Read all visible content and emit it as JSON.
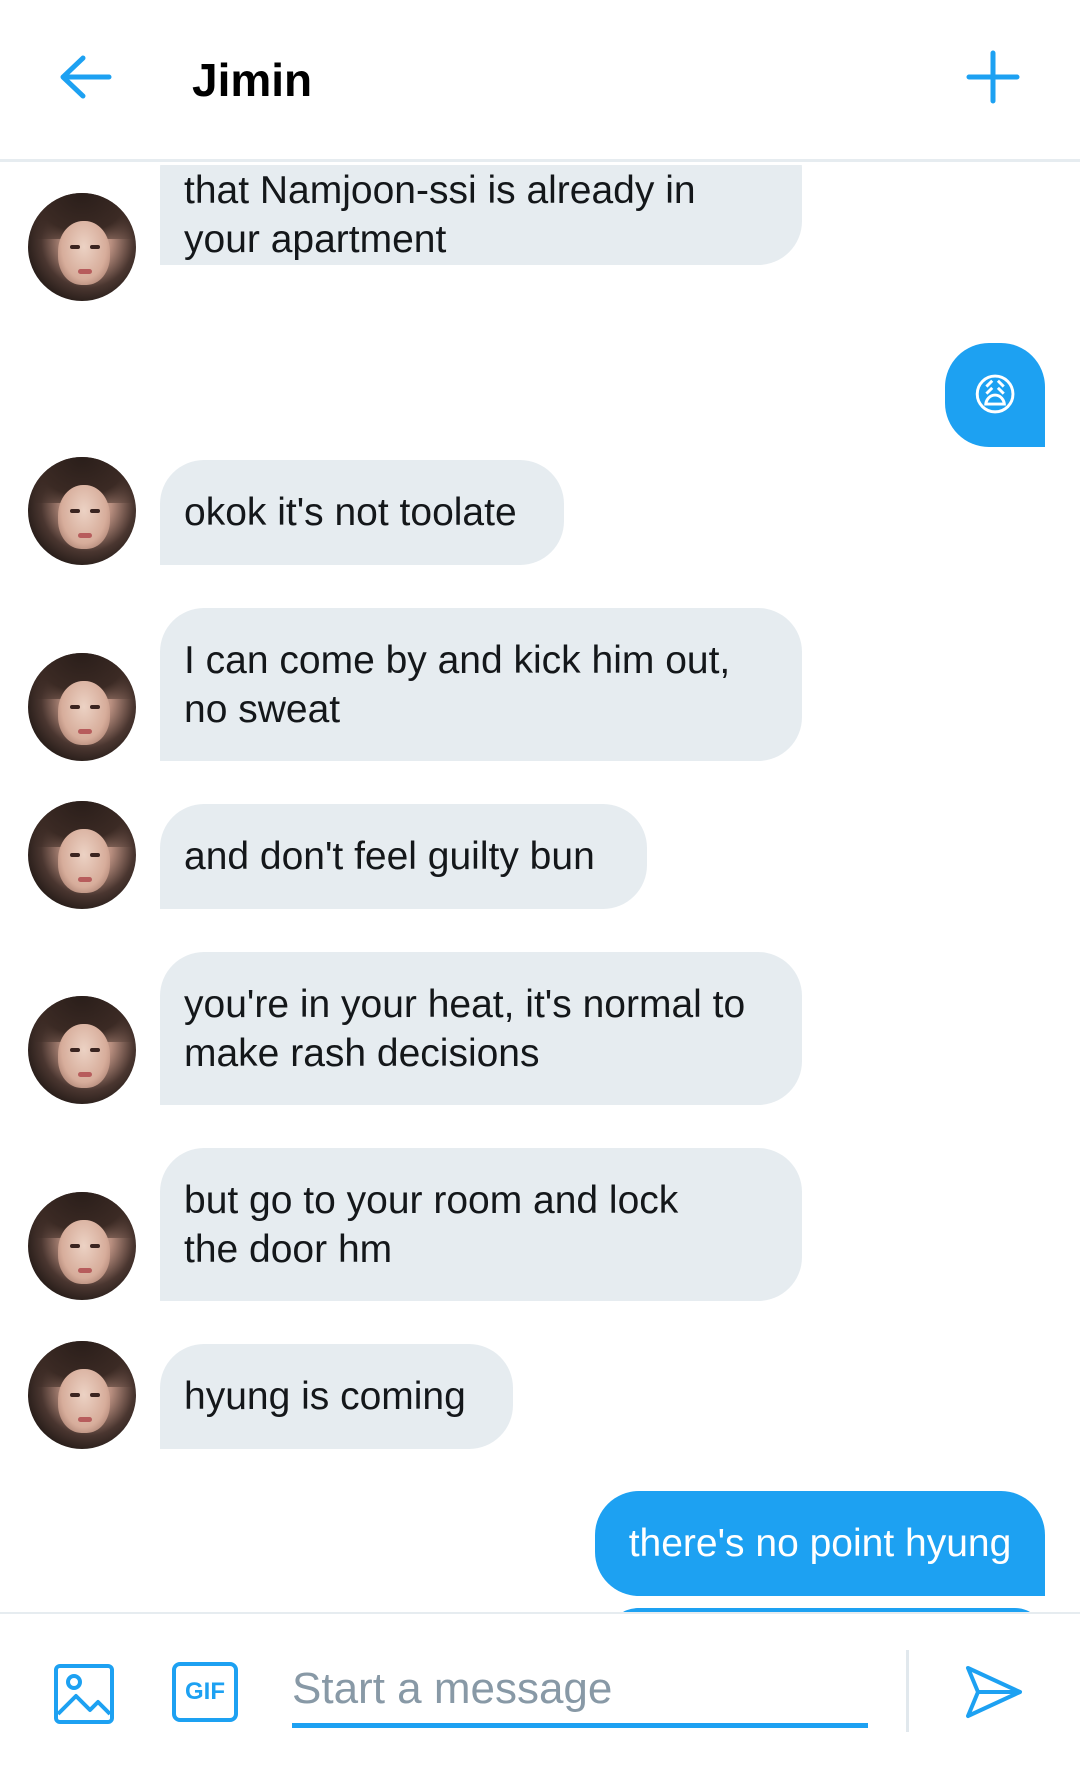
{
  "header": {
    "title": "Jimin",
    "back_icon": "arrow-left-icon",
    "add_icon": "plus-icon"
  },
  "colors": {
    "accent": "#1da1f2",
    "incoming_bubble": "#e6ecf0",
    "divider": "#e6ecf0"
  },
  "messages": [
    {
      "direction": "in",
      "text": "that Namjoon-ssi is already in\nyour apartment"
    },
    {
      "direction": "out",
      "text": "😩"
    },
    {
      "direction": "in",
      "text": "okok it's not toolate"
    },
    {
      "direction": "in",
      "text": "I can come by and kick him out,\nno sweat"
    },
    {
      "direction": "in",
      "text": "and don't feel guilty bun"
    },
    {
      "direction": "in",
      "text": "you're in your heat, it's normal to\nmake rash decisions"
    },
    {
      "direction": "in",
      "text": "but go to your room and lock\nthe door hm"
    },
    {
      "direction": "in",
      "text": "hyung is coming"
    },
    {
      "direction": "out",
      "text": "there's no point hyung"
    }
  ],
  "compose": {
    "image_icon": "image-icon",
    "gif_label": "GIF",
    "placeholder": "Start a message",
    "value": "",
    "send_icon": "send-icon"
  }
}
